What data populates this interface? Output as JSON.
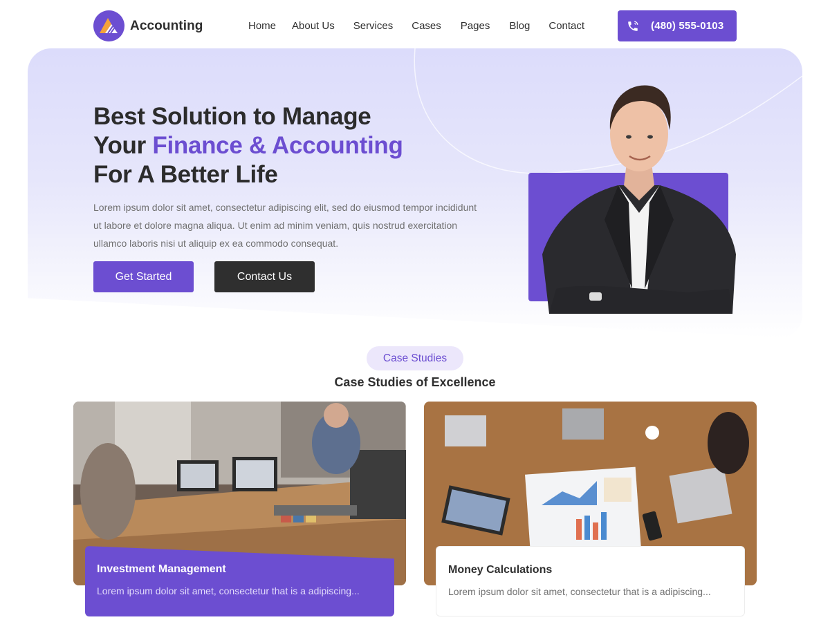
{
  "brand": {
    "name": "Accounting"
  },
  "nav": {
    "items": [
      {
        "label": "Home"
      },
      {
        "label": "About Us"
      },
      {
        "label": "Services"
      },
      {
        "label": "Cases"
      },
      {
        "label": "Pages"
      },
      {
        "label": "Blog"
      },
      {
        "label": "Contact"
      }
    ]
  },
  "header": {
    "phone": "(480) 555-0103",
    "phone_icon": "phone-icon"
  },
  "hero": {
    "title_line1": "Best Solution to Manage",
    "title_line2_prefix": "Your ",
    "title_line2_accent": "Finance & Accounting",
    "title_line3": "For A Better Life",
    "description": "Lorem ipsum dolor sit amet, consectetur adipiscing elit, sed do eiusmod tempor incididunt ut labore et dolore magna aliqua. Ut enim ad minim veniam, quis nostrud exercitation ullamco laboris nisi ut aliquip ex ea commodo consequat.",
    "primary_button": "Get Started",
    "secondary_button": "Contact Us"
  },
  "cases": {
    "badge": "Case Studies",
    "title": "Case Studies of Excellence",
    "items": [
      {
        "title": "Investment Management",
        "excerpt": "Lorem ipsum dolor sit amet, consectetur that is a adipiscing..."
      },
      {
        "title": "Money Calculations",
        "excerpt": "Lorem ipsum dolor sit amet, consectetur that is a adipiscing..."
      }
    ]
  },
  "colors": {
    "accent": "#6c4ed1",
    "dark": "#2f2f2f",
    "text_muted": "#707070",
    "hero_bg": "#e0e0fb"
  }
}
